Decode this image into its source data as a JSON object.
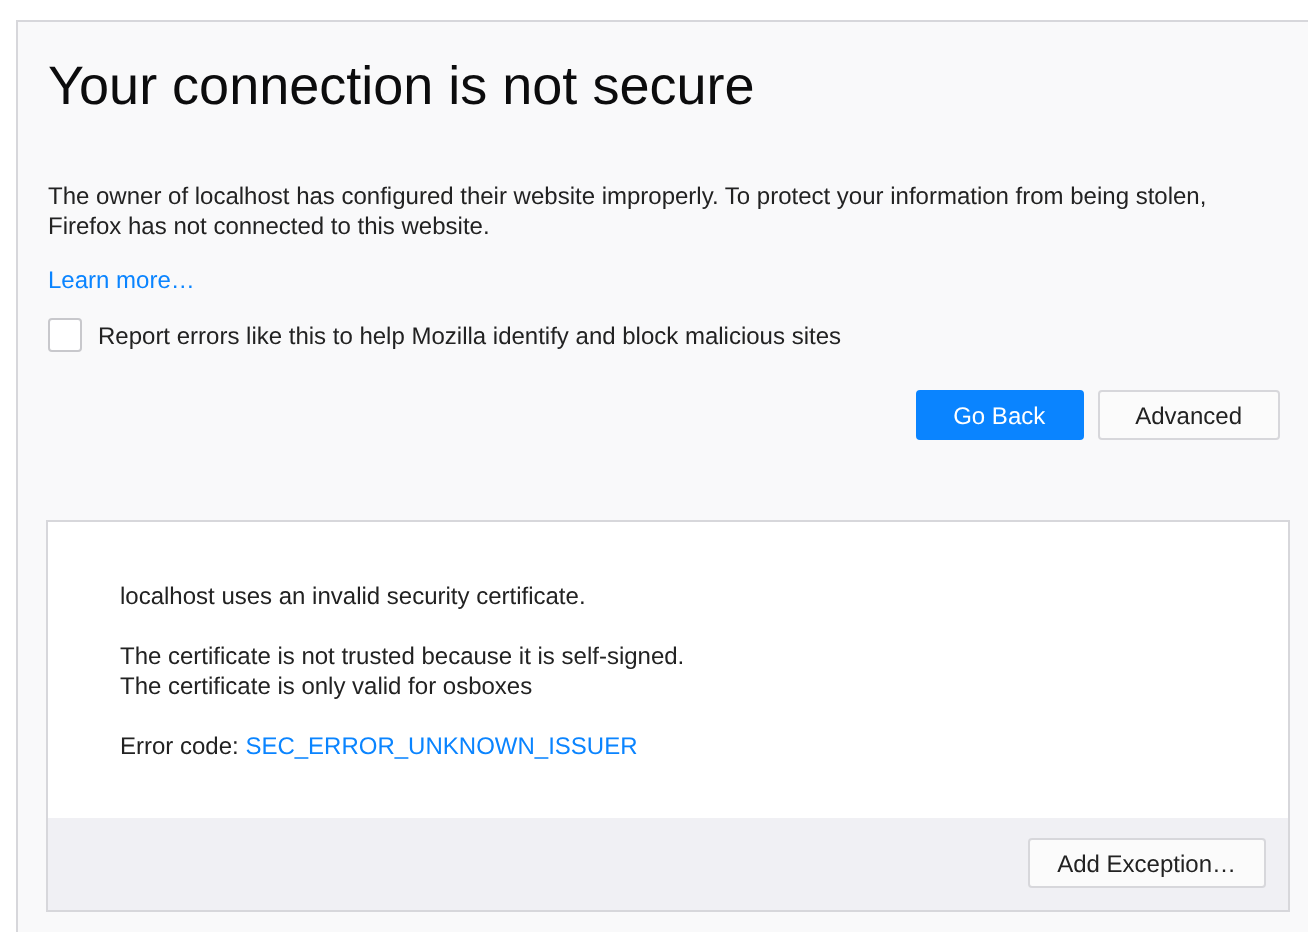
{
  "title": "Your connection is not secure",
  "description": "The owner of localhost has configured their website improperly. To protect your information from being stolen, Firefox has not connected to this website.",
  "learn_more": "Learn more…",
  "report_checkbox": {
    "label": "Report errors like this to help Mozilla identify and block malicious sites",
    "checked": false
  },
  "buttons": [
    {
      "label": "Go Back",
      "kind": "primary"
    },
    {
      "label": "Advanced",
      "kind": "secondary"
    }
  ],
  "advanced": {
    "paragraphs": [
      [
        "localhost uses an invalid security certificate."
      ],
      [
        "The certificate is not trusted because it is self-signed.",
        "The certificate is only valid for osboxes"
      ]
    ],
    "error_code": {
      "label": "Error code:",
      "code": "SEC_ERROR_UNKNOWN_ISSUER"
    },
    "button": "Add Exception…"
  }
}
